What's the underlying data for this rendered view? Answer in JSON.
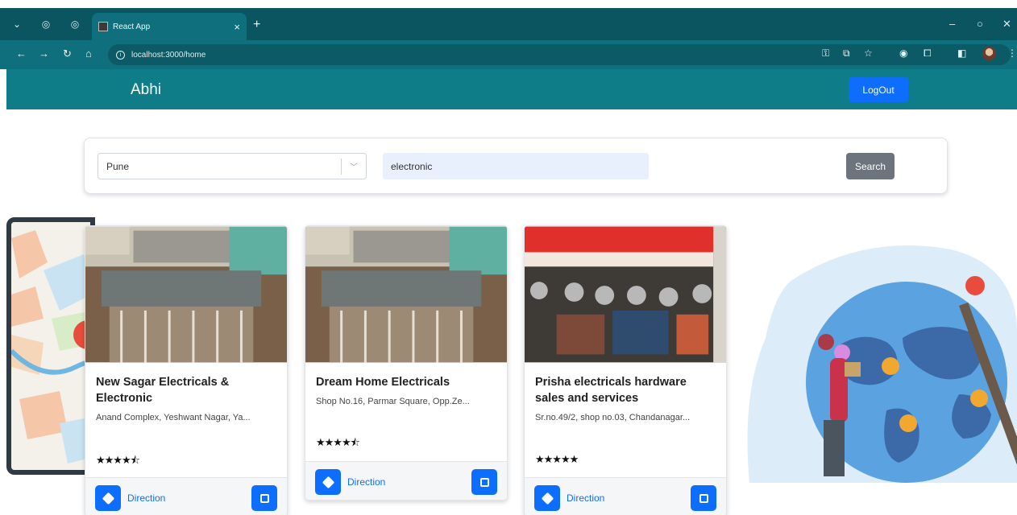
{
  "browser": {
    "tab_title": "React App",
    "url": "localhost:3000/home",
    "tab_close": "×",
    "new_tab": "+"
  },
  "navbar": {
    "brand": "Abhi",
    "logout_label": "LogOut"
  },
  "search": {
    "city_value": "Pune",
    "query_value": "electronic",
    "button_label": "Search"
  },
  "shops": [
    {
      "name": "New Sagar Electricals & Electronic",
      "address": "Anand Complex, Yeshwant Nagar, Ya...",
      "stars": "★★★★⯪",
      "direction_label": "Direction"
    },
    {
      "name": "Dream Home Electricals",
      "address": "Shop No.16, Parmar Square, Opp.Ze...",
      "stars": "★★★★⯪",
      "direction_label": "Direction"
    },
    {
      "name": "Prisha electricals hardware sales and services",
      "address": "Sr.no.49/2, shop no.03, Chandanagar...",
      "stars": "★★★★★",
      "direction_label": "Direction"
    }
  ],
  "colors": {
    "navbar": "#0e7d88",
    "primary": "#0d6efd",
    "secondary": "#6c757d"
  }
}
